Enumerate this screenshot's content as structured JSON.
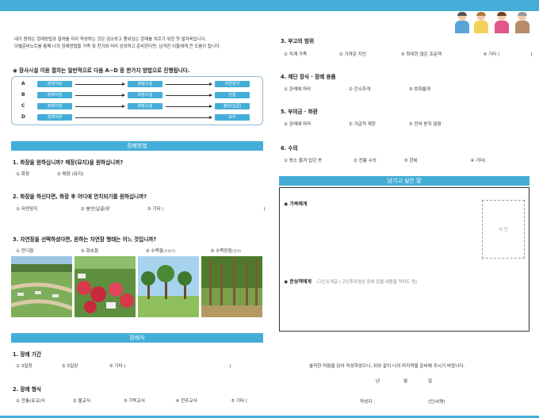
{
  "intro": {
    "line1": "내가 원하는 장례방법과 절차를 미리 작성하는 것은 검소하고 품위있는 장례를 치르기 위한 첫 발자욱입니다.",
    "line2": "이별준비노트를 통해 나의 장례방법을 가족 및 친지와 미리 상의하고 준비한다면, 남겨진 이들에게 큰 도움이 됩니다."
  },
  "facility": {
    "title": "◉ 장사시설 이용 절차는 일반적으로 다음 A~D 중 한가지 방법으로 진행됩니다.",
    "rows": [
      {
        "key": "A",
        "s1": "장례식장",
        "s2": "화장시설",
        "s3": "자연장지"
      },
      {
        "key": "B",
        "s1": "장례식장",
        "s2": "화장시설",
        "s3": "산골"
      },
      {
        "key": "C",
        "s1": "장례식장",
        "s2": "화장시설",
        "s3": "봉안(납골)"
      },
      {
        "key": "D",
        "s1": "장례식장",
        "s2": "",
        "s3": "묘지"
      }
    ]
  },
  "funeral_method": {
    "band": "장례방법",
    "q1": {
      "title": "1. 화장을 원하십니까? 매장(묘지)을 원하십니까?",
      "opts": [
        "① 화장",
        "② 매장 (묘지)"
      ]
    },
    "q2": {
      "title": "2. 화장을 하신다면, 화장 후 어디에 안치되기를 원하십니까?",
      "opts": [
        "① 자연장지",
        "② 봉안(납골)당",
        "③ 기타 (",
        ")"
      ]
    },
    "q3": {
      "title": "3. 자연장을 선택하셨다면, 원하는 자연장 형태는 어느 것입니까?",
      "opts": [
        "① 잔디형",
        "② 화초형",
        "③ 수목형",
        "④ 수목장림"
      ],
      "sub3": "(조성지)",
      "sub4": "(임야)"
    }
  },
  "ceremony": {
    "band": "장례식",
    "q1": {
      "title": "1. 장례 기간",
      "opts": [
        "① 3일장",
        "② 5일장",
        "③ 기타 (",
        ")"
      ]
    },
    "q2": {
      "title": "2. 장례 형식",
      "opts": [
        "① 전통(유교)식",
        "② 불교식",
        "③ 기독교식",
        "④ 천주교식",
        "⑤ 기타 ("
      ]
    }
  },
  "right": {
    "q3": {
      "title": "3. 부고의 범위",
      "opts": [
        "① 직계 가족",
        "② 가까운 지인",
        "③ 최대한 많은 조문객",
        "④ 기타 (",
        ")"
      ]
    },
    "q4": {
      "title": "4. 제단 장식 · 장례 용품",
      "opts": [
        "① 관례에 따라",
        "② 간소하게",
        "③ 호화롭게"
      ]
    },
    "q5": {
      "title": "5. 부의금 · 화환",
      "opts": [
        "① 관례에 따라",
        "② 가급적 제한",
        "③ 전혀 받지 않음"
      ]
    },
    "q6": {
      "title": "6. 수의",
      "opts": [
        "① 평소 즐겨 입던 옷",
        "② 전통 수의",
        "③ 한복",
        "④ 기타(",
        ")"
      ]
    }
  },
  "message": {
    "band": "남기고 싶은 말",
    "family": "◉ 가족에게",
    "photo": "사 진",
    "guests": "◉ 문상객에게",
    "guests_hint": "(고인소개글 / 고인추모영상 등에 담을 내용을 적어도 됨)"
  },
  "signature": {
    "statement": "솔직한 마음을 담아 작성하였으니, 위와 같이 나의 마지막을 준비해 주시기 바랍니다.",
    "year": "년",
    "month": "월",
    "day": "일",
    "writer": "작성자 :",
    "seal": "(인/서명)"
  },
  "colors": {
    "accent": "#45aed8"
  }
}
